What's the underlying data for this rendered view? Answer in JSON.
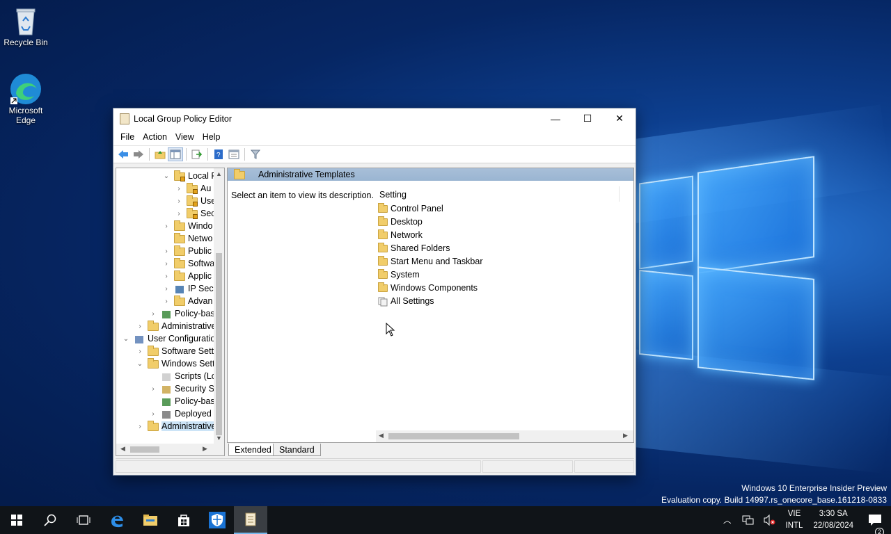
{
  "desktop": {
    "icons": [
      {
        "label": "Recycle Bin",
        "icon": "recycle-bin-icon"
      },
      {
        "label": "Microsoft Edge",
        "icon": "edge-icon"
      }
    ],
    "watermark_line1": "Windows 10 Enterprise Insider Preview",
    "watermark_line2": "Evaluation copy. Build 14997.rs_onecore_base.161218-0833"
  },
  "window": {
    "title": "Local Group Policy Editor",
    "controls": {
      "minimize": "—",
      "maximize": "☐",
      "close": "✕"
    },
    "menu": [
      "File",
      "Action",
      "View",
      "Help"
    ],
    "toolbar": [
      "back-icon",
      "forward-icon",
      "up-folder-icon",
      "show-hide-tree-icon",
      "export-list-icon",
      "help-icon",
      "properties-icon",
      "filter-icon"
    ]
  },
  "tree": {
    "items": [
      {
        "label": "Local P",
        "chevron": "⌄",
        "icon": "lock-folder"
      },
      {
        "label": "Au",
        "chevron": "›",
        "icon": "lock-folder"
      },
      {
        "label": "Use",
        "chevron": "›",
        "icon": "lock-folder"
      },
      {
        "label": "Sec",
        "chevron": "›",
        "icon": "lock-folder"
      },
      {
        "label": "Windo",
        "chevron": "›",
        "icon": "folder"
      },
      {
        "label": "Netwo",
        "chevron": "",
        "icon": "folder"
      },
      {
        "label": "Public",
        "chevron": "›",
        "icon": "folder"
      },
      {
        "label": "Softwa",
        "chevron": "›",
        "icon": "folder"
      },
      {
        "label": "Applic",
        "chevron": "›",
        "icon": "folder"
      },
      {
        "label": "IP Secu",
        "chevron": "›",
        "icon": "ipsec"
      },
      {
        "label": "Advan",
        "chevron": "›",
        "icon": "folder"
      },
      {
        "label": "Policy-bas",
        "chevron": "›",
        "icon": "chart"
      },
      {
        "label": "Administrative",
        "chevron": "›",
        "icon": "folder"
      },
      {
        "label": "User Configuratio",
        "chevron": "⌄",
        "icon": "user"
      },
      {
        "label": "Software Setti",
        "chevron": "›",
        "icon": "folder"
      },
      {
        "label": "Windows Sett",
        "chevron": "⌄",
        "icon": "folder"
      },
      {
        "label": "Scripts (Lo",
        "chevron": "",
        "icon": "script"
      },
      {
        "label": "Security Se",
        "chevron": "›",
        "icon": "security"
      },
      {
        "label": "Policy-bas",
        "chevron": "",
        "icon": "chart"
      },
      {
        "label": "Deployed",
        "chevron": "›",
        "icon": "printer"
      },
      {
        "label": "Administrative",
        "chevron": "›",
        "icon": "folder",
        "selected": true
      }
    ]
  },
  "right": {
    "header": "Administrative Templates",
    "description": "Select an item to view its description.",
    "column": "Setting",
    "items": [
      {
        "label": "Control Panel",
        "icon": "folder"
      },
      {
        "label": "Desktop",
        "icon": "folder"
      },
      {
        "label": "Network",
        "icon": "folder"
      },
      {
        "label": "Shared Folders",
        "icon": "folder"
      },
      {
        "label": "Start Menu and Taskbar",
        "icon": "folder"
      },
      {
        "label": "System",
        "icon": "folder"
      },
      {
        "label": "Windows Components",
        "icon": "folder"
      },
      {
        "label": "All Settings",
        "icon": "all-settings"
      }
    ],
    "tabs": {
      "extended": "Extended",
      "standard": "Standard"
    }
  },
  "taskbar": {
    "apps": [
      "start-icon",
      "search-icon",
      "task-view-icon",
      "edge-icon",
      "file-explorer-icon",
      "store-icon",
      "defender-icon",
      "gpedit-icon"
    ],
    "tray": {
      "lang_top": "VIE",
      "lang_bottom": "INTL",
      "time": "3:30 SA",
      "date": "22/08/2024",
      "notifications": "2"
    }
  },
  "colors": {
    "accent": "#76b9ed",
    "selection": "#cce4f7",
    "header": "#9ab5d2"
  }
}
